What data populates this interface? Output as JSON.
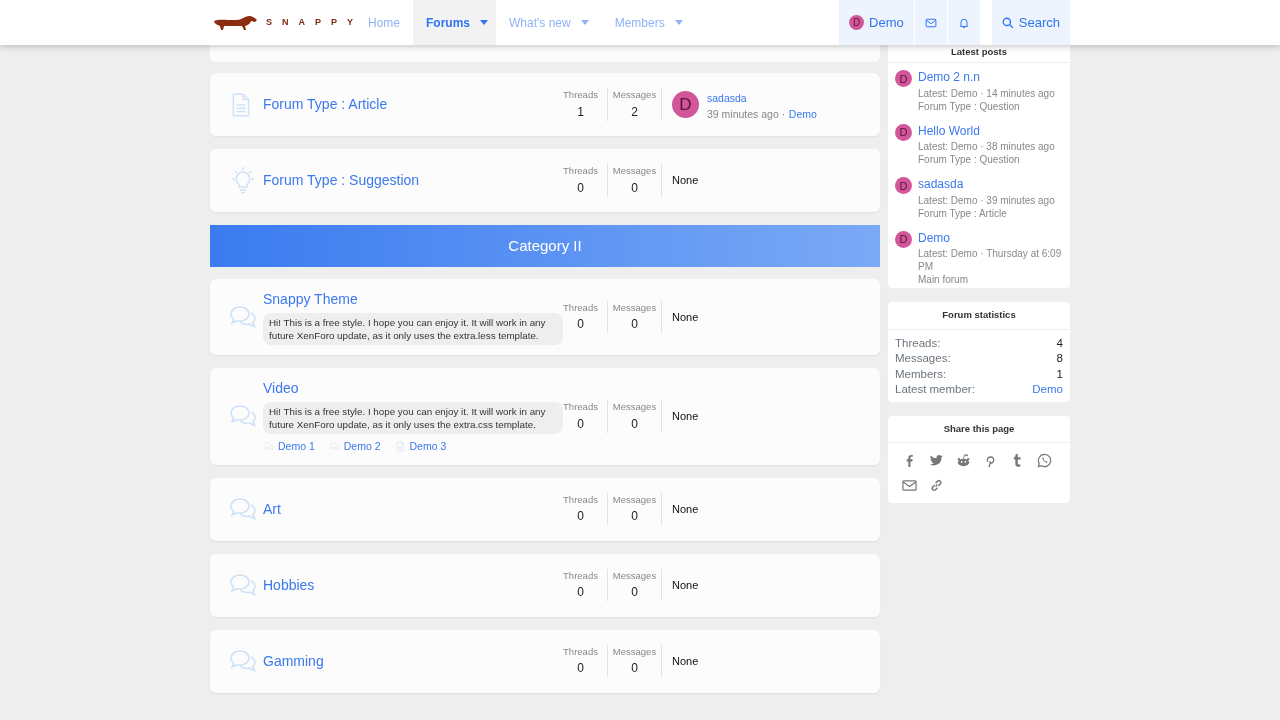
{
  "navbar": {
    "logo_text": "SNAPPY",
    "items": [
      {
        "label": "Home",
        "selected": false,
        "dropdown": false
      },
      {
        "label": "Forums",
        "selected": true,
        "dropdown": true
      },
      {
        "label": "What's new",
        "selected": false,
        "dropdown": true
      },
      {
        "label": "Members",
        "selected": false,
        "dropdown": true
      }
    ],
    "user": {
      "avatar": "D",
      "name": "Demo"
    },
    "search": "Search"
  },
  "forums_top": [
    {
      "kind": "article",
      "title": "Forum Type : Article",
      "threads": {
        "label": "Threads",
        "value": "1"
      },
      "messages": {
        "label": "Messages",
        "value": "2"
      },
      "latest": {
        "avatar": "D",
        "title": "sadasda",
        "time": "39 minutes ago ·",
        "user": "Demo"
      }
    },
    {
      "kind": "suggestion",
      "title": "Forum Type : Suggestion",
      "threads": {
        "label": "Threads",
        "value": "0"
      },
      "messages": {
        "label": "Messages",
        "value": "0"
      },
      "none": "None"
    }
  ],
  "category": {
    "title": "Category II",
    "forums": [
      {
        "kind": "chat",
        "title": "Snappy Theme",
        "description": "Hi! This is a free style. I hope you can enjoy it. It will work in any future XenForo update, as it only uses the extra.less template.",
        "threads": {
          "label": "Threads",
          "value": "0"
        },
        "messages": {
          "label": "Messages",
          "value": "0"
        },
        "none": "None"
      },
      {
        "kind": "chat",
        "title": "Video",
        "description": "Hi! This is a free style. I hope you can enjoy it. It will work in any future XenForo update, as it only uses the extra.css template.",
        "subforums": [
          {
            "kind": "chat",
            "label": "Demo 1"
          },
          {
            "kind": "chat",
            "label": "Demo 2"
          },
          {
            "kind": "article",
            "label": "Demo 3"
          }
        ],
        "threads": {
          "label": "Threads",
          "value": "0"
        },
        "messages": {
          "label": "Messages",
          "value": "0"
        },
        "none": "None"
      },
      {
        "kind": "chat",
        "title": "Art",
        "threads": {
          "label": "Threads",
          "value": "0"
        },
        "messages": {
          "label": "Messages",
          "value": "0"
        },
        "none": "None"
      },
      {
        "kind": "chat",
        "title": "Hobbies",
        "threads": {
          "label": "Threads",
          "value": "0"
        },
        "messages": {
          "label": "Messages",
          "value": "0"
        },
        "none": "None"
      },
      {
        "kind": "chat",
        "title": "Gamming",
        "threads": {
          "label": "Threads",
          "value": "0"
        },
        "messages": {
          "label": "Messages",
          "value": "0"
        },
        "none": "None"
      }
    ]
  },
  "sidebar": {
    "latest_posts": {
      "title": "Latest posts",
      "items": [
        {
          "avatar": "D",
          "title": "Demo 2 n.n",
          "meta": "Latest: Demo · 14 minutes ago",
          "forum": "Forum Type : Question"
        },
        {
          "avatar": "D",
          "title": "Hello World",
          "meta": "Latest: Demo · 38 minutes ago",
          "forum": "Forum Type : Question"
        },
        {
          "avatar": "D",
          "title": "sadasda",
          "meta": "Latest: Demo · 39 minutes ago",
          "forum": "Forum Type : Article"
        },
        {
          "avatar": "D",
          "title": "Demo",
          "meta": "Latest: Demo · Thursday at 6:09 PM",
          "forum": "Main forum"
        }
      ]
    },
    "statistics": {
      "title": "Forum statistics",
      "rows": [
        {
          "label": "Threads:",
          "value": "4",
          "kind": "text"
        },
        {
          "label": "Messages:",
          "value": "8",
          "kind": "text"
        },
        {
          "label": "Members:",
          "value": "1",
          "kind": "text"
        },
        {
          "label": "Latest member:",
          "value": "Demo",
          "kind": "link"
        }
      ]
    },
    "share": {
      "title": "Share this page"
    }
  }
}
